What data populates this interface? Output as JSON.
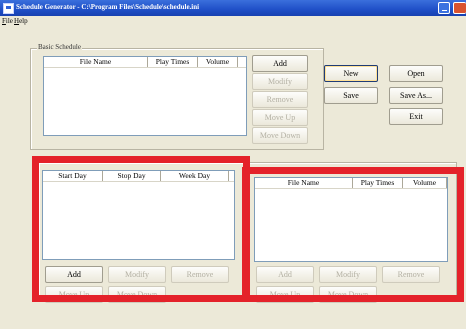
{
  "window": {
    "title": "Schedule Generator - C:\\Program Files\\Schedule\\schedule.ini"
  },
  "menu": {
    "items": [
      {
        "label": "File",
        "hotkey": "F"
      },
      {
        "label": "Help",
        "hotkey": "H"
      }
    ]
  },
  "basic_schedule": {
    "label": "Basic Schedule",
    "columns": [
      "File Name",
      "Play Times",
      "Volume"
    ],
    "buttons": {
      "add": "Add",
      "modify": "Modify",
      "remove": "Remove",
      "move_up": "Move Up",
      "move_down": "Move Down"
    }
  },
  "right_buttons": {
    "new": "New",
    "open": "Open",
    "save": "Save",
    "save_as": "Save As...",
    "exit": "Exit"
  },
  "day_list": {
    "columns": [
      "Start Day",
      "Stop Day",
      "Week Day"
    ],
    "buttons": {
      "add": "Add",
      "modify": "Modify",
      "remove": "Remove",
      "move_up": "Move Up",
      "move_down": "Move Down"
    }
  },
  "special_file_list": {
    "columns": [
      "File Name",
      "Play Times",
      "Volume"
    ],
    "buttons": {
      "add": "Add",
      "modify": "Modify",
      "remove": "Remove",
      "move_up": "Move Up",
      "move_down": "Move Down"
    }
  },
  "colors": {
    "titlebar": "#1f4fc7",
    "highlight": "#e4222a",
    "face": "#ece9d8"
  }
}
